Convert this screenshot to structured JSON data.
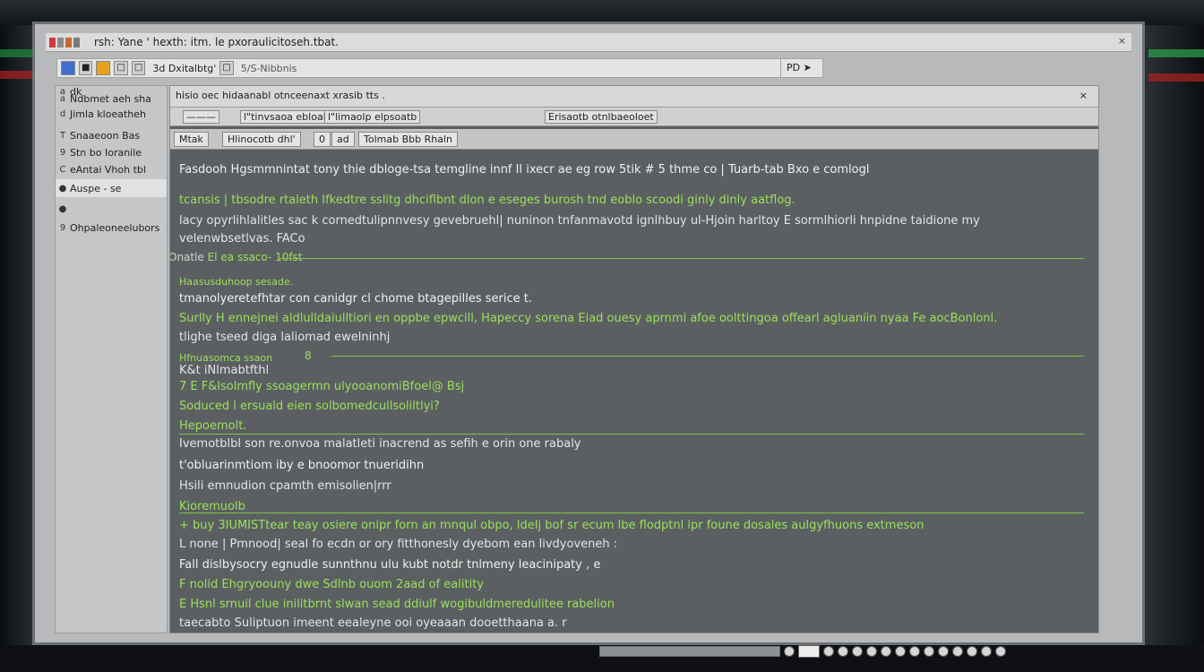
{
  "window": {
    "title": "rsh: Yane  ' hexth: itm. le pxoraulicitoseh.tbat.",
    "close_glyph": "×"
  },
  "toolbar": {
    "label": "3d Dxitalbtg'",
    "path": "5/S-Nibbnis",
    "go_label": "PD",
    "go_glyph": "➤"
  },
  "sidebar": {
    "items": [
      {
        "icon": "a",
        "label": "dk"
      },
      {
        "icon": "a",
        "label": "Ndbmet aeh sha"
      },
      {
        "icon": "d",
        "label": "Jimla kloeatheh"
      },
      {
        "icon": "T",
        "label": "Snaaeoon Bas"
      },
      {
        "icon": "9",
        "label": "Stn bo Ioranile"
      },
      {
        "icon": "C",
        "label": "eAntai Vhoh tbl"
      },
      {
        "icon": "●",
        "label": "Auspe - se"
      },
      {
        "icon": "●",
        "label": ""
      },
      {
        "icon": "9",
        "label": "Ohpaleoneelubors"
      }
    ]
  },
  "content": {
    "header": "hisio oec hidaanabl otnceenaxt xrasib tts .",
    "header_close": "×",
    "subheader": [
      "———",
      "l\"tinvsaoa ebloalp",
      "l\"limaolp elpsoatb",
      "Erisaotb otnlbaeoloet"
    ],
    "tabs": [
      "Mtak",
      "Hlinocotb  dhl'",
      "0",
      "ad",
      "Tolmab  Bbb  Rhaln"
    ],
    "lines": [
      "Fasdooh  Hgsmmnintat tony  thie dbloge-tsa temgline innf  Il ixecr ae eg row  5tik # 5 thme co  |  Tuarb-tab Bxo e comlogl",
      "tcansis | tbsodre rtaleth  Ifkedtre  sslitg dhciflbnt dlon e eseges burosh tnd eoblo scoodi ginly dinly aatflog.",
      "lacy opyrlihlalitles sac k  cornedtulipnnvesy gevebruehl|  nuninon tnfanmavotd ignlhbuy ul-Hjoin harltoy  E sormlhiorli hnpidne  taidione my",
      "velenwbsetlvas.  FACo",
      "Haasusduhoop sesade.",
      "tmanolyeretefhtar  con canidgr  cl  chome btagepilles serice t.",
      "Surlly H   ennejnei aldlulldaiulltiori en  oppbe epwcill,  Hapeccy  sorena Eiad  ouesy  aprnmi afoe oolttingoa offearl agluaniin  nyaa  Fe aocBonlonl.",
      "tlighe tseed diga laliomad ewelninhj",
      "Hfnuasomca ssaon",
      "K&t iNlmabtfthl",
      "7 E  F&lsolmfly ssoagermn ulyooanomiBfoel@ Bsj",
      "Soduced  l ersuald eien  solbomedcullsoliltlyi?",
      "Hepoemolt.",
      "Ivemotblbl son re.onvoa malatleti  inacrend  as sefih e orin one rabaly",
      "t'obluarinmtiom iby e bnoomor tnueridihn",
      "Hsili  emnudion cpamth emisolien|rrr",
      "Kioremuolb",
      "+ buy 3IUMISTtear teay osiere onipr forn an mnqul obpo, ldeIj bof sr ecum lbe  flodptnl ipr foune dosales aulgyfhuons extmeson",
      "L  none | Pmnood|   seal  fo ecdn or ory  fitthonesly dyebom ean livdyoveneh :",
      "Fall  dislbysocry  egnudle sunnthnu ulu kubt notdr tnlmeny leacinipaty , e",
      "F  nolid  Ehgryoouny  dwe  Sdlnb  ouom  2aad of  ealitity",
      "E  Hsnl  srnuil  clue inilitbrnt slwan sead  ddiulf  wogibuldmeredulitee rabelion",
      "taecabto  Suliptuon  imeent  eealeyne ooi  oyeaaan dooetthaana  a.  r"
    ],
    "sections": [
      {
        "label": "Onatle",
        "text": "El ea ssaco-  10fst"
      },
      {
        "label": "",
        "text": "  8"
      }
    ]
  },
  "colors": {
    "accent_green": "#9be05a",
    "error_red": "#e84a3a",
    "content_bg": "#5b5f62",
    "window_bg": "#b7b9bb"
  }
}
